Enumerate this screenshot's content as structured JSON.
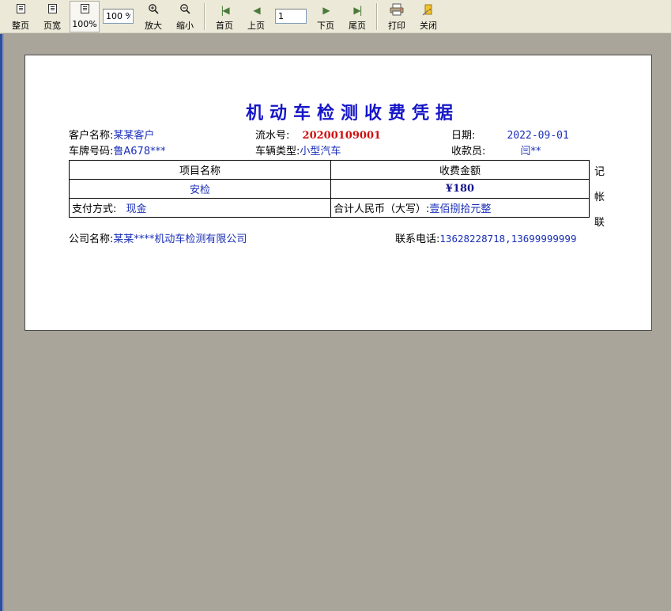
{
  "toolbar": {
    "whole_page": "整页",
    "page_width": "页宽",
    "zoom_100": "100%",
    "zoom_value": "100 %",
    "zoom_in": "放大",
    "zoom_out": "缩小",
    "first_page": "首页",
    "prev_page": "上页",
    "page_number": "1",
    "next_page": "下页",
    "last_page": "尾页",
    "print": "打印",
    "close": "关闭"
  },
  "receipt": {
    "title": "机动车检测收费凭据",
    "customer_label": "客户名称:",
    "customer_value": "某某客户",
    "serial_label": "流水号:",
    "serial_value": "20200109001",
    "date_label": "日期:",
    "date_value": "2022-09-01",
    "plate_label": "车牌号码:",
    "plate_value": "鲁A678***",
    "vehicle_type_label": "车辆类型:",
    "vehicle_type_value": "小型汽车",
    "cashier_label": "收款员:",
    "cashier_value": "闫**",
    "table": {
      "col_item": "项目名称",
      "col_amount": "收费金额",
      "item_value": "安检",
      "amount_value": "¥180",
      "payment_label": "支付方式:",
      "payment_value": "现金",
      "total_label": "合计人民币（大写）:",
      "total_value": "壹佰捌拾元整"
    },
    "side_chars": [
      "记",
      "帐",
      "联"
    ],
    "company_label": "公司名称:",
    "company_value": "某某****机动车检测有限公司",
    "phone_label": "联系电话:",
    "phone_value": "13628228718,13699999999"
  }
}
